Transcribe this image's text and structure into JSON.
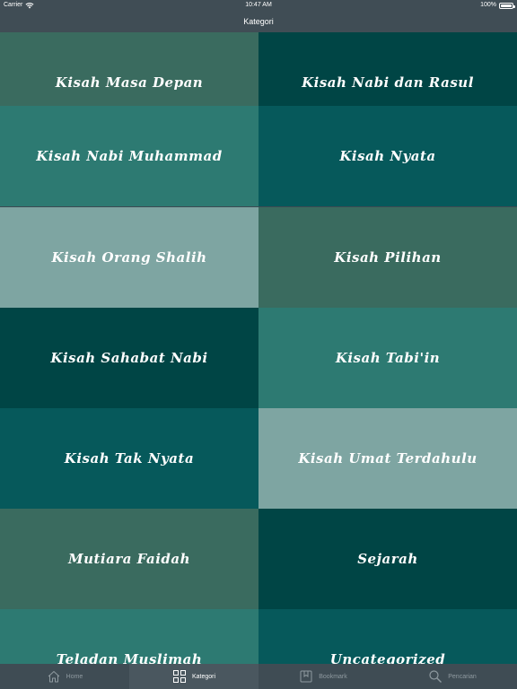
{
  "status": {
    "carrier": "Carrier",
    "time": "10:47 AM",
    "battery": "100%"
  },
  "nav": {
    "title": "Kategori"
  },
  "categories": [
    {
      "label": "Kisah Masa Depan",
      "color": "#3a6b5f"
    },
    {
      "label": "Kisah Nabi dan Rasul",
      "color": "#004545"
    },
    {
      "label": "Kisah Nabi Muhammad",
      "color": "#2d7a72"
    },
    {
      "label": "Kisah Nyata",
      "color": "#06595b"
    },
    {
      "label": "Kisah Orang Shalih",
      "color": "#7ea5a2"
    },
    {
      "label": "Kisah Pilihan",
      "color": "#3a6b5f"
    },
    {
      "label": "Kisah Sahabat Nabi",
      "color": "#004545"
    },
    {
      "label": "Kisah Tabi'in",
      "color": "#2d7a72"
    },
    {
      "label": "Kisah Tak Nyata",
      "color": "#06595b"
    },
    {
      "label": "Kisah Umat Terdahulu",
      "color": "#7ea5a2"
    },
    {
      "label": "Mutiara Faidah",
      "color": "#3a6b5f"
    },
    {
      "label": "Sejarah",
      "color": "#004545"
    },
    {
      "label": "Teladan Muslimah",
      "color": "#2d7a72"
    },
    {
      "label": "Uncategorized",
      "color": "#06595b"
    }
  ],
  "tabs": [
    {
      "label": "Home",
      "icon": "home-icon",
      "active": false
    },
    {
      "label": "Kategori",
      "icon": "grid-icon",
      "active": true
    },
    {
      "label": "Bookmark",
      "icon": "bookmark-icon",
      "active": false
    },
    {
      "label": "Pencarian",
      "icon": "search-icon",
      "active": false
    }
  ]
}
